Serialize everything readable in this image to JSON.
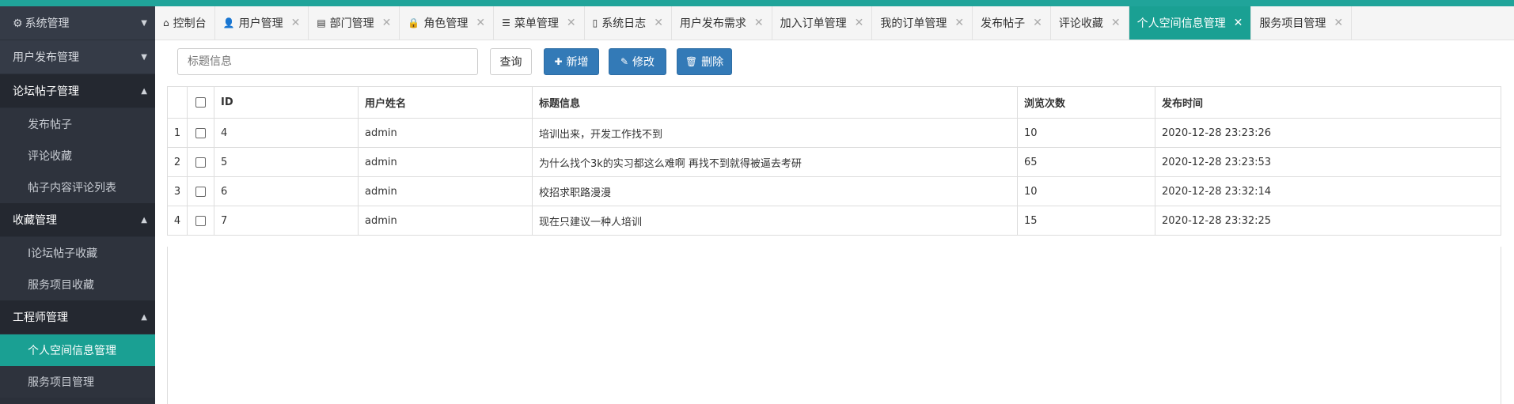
{
  "sidebar": {
    "items": [
      {
        "type": "group",
        "label": "系统管理",
        "icon": "gear-icon",
        "arrow": "▼",
        "open": false
      },
      {
        "type": "group",
        "label": "用户发布管理",
        "arrow": "▼",
        "open": false
      },
      {
        "type": "group",
        "label": "论坛帖子管理",
        "arrow": "▲",
        "open": true
      },
      {
        "type": "sub",
        "label": "发布帖子"
      },
      {
        "type": "sub",
        "label": "评论收藏"
      },
      {
        "type": "sub",
        "label": "帖子内容评论列表"
      },
      {
        "type": "group",
        "label": "收藏管理",
        "arrow": "▲",
        "open": true
      },
      {
        "type": "sub",
        "label": "I论坛帖子收藏"
      },
      {
        "type": "sub",
        "label": "服务项目收藏"
      },
      {
        "type": "group",
        "label": "工程师管理",
        "arrow": "▲",
        "open": true
      },
      {
        "type": "sub",
        "label": "个人空间信息管理",
        "active": true
      },
      {
        "type": "sub",
        "label": "服务项目管理"
      }
    ]
  },
  "tabs": [
    {
      "label": "控制台",
      "icon": "home-icon",
      "glyph": "⌂",
      "closable": false
    },
    {
      "label": "用户管理",
      "icon": "user-icon",
      "glyph": "👤",
      "closable": true
    },
    {
      "label": "部门管理",
      "icon": "document-icon",
      "glyph": "▤",
      "closable": true
    },
    {
      "label": "角色管理",
      "icon": "lock-icon",
      "glyph": "🔒",
      "closable": true
    },
    {
      "label": "菜单管理",
      "icon": "list-icon",
      "glyph": "☰",
      "closable": true
    },
    {
      "label": "系统日志",
      "icon": "file-icon",
      "glyph": "▯",
      "closable": true
    },
    {
      "label": "用户发布需求",
      "closable": true
    },
    {
      "label": "加入订单管理",
      "closable": true
    },
    {
      "label": "我的订单管理",
      "closable": true
    },
    {
      "label": "发布帖子",
      "closable": true
    },
    {
      "label": "评论收藏",
      "closable": true
    },
    {
      "label": "个人空间信息管理",
      "closable": true,
      "active": true
    },
    {
      "label": "服务项目管理",
      "closable": true
    }
  ],
  "toolbar": {
    "search_placeholder": "标题信息",
    "query_label": "查询",
    "add_label": "新增",
    "edit_label": "修改",
    "delete_label": "删除"
  },
  "table": {
    "columns": [
      "ID",
      "用户姓名",
      "标题信息",
      "浏览次数",
      "发布时间"
    ],
    "rows": [
      {
        "index": "1",
        "id": "4",
        "user": "admin",
        "title": "培训出来，开发工作找不到",
        "views": "10",
        "time": "2020-12-28 23:23:26"
      },
      {
        "index": "2",
        "id": "5",
        "user": "admin",
        "title": "为什么找个3k的实习都这么难啊 再找不到就得被逼去考研",
        "views": "65",
        "time": "2020-12-28 23:23:53"
      },
      {
        "index": "3",
        "id": "6",
        "user": "admin",
        "title": "校招求职路漫漫",
        "views": "10",
        "time": "2020-12-28 23:32:14"
      },
      {
        "index": "4",
        "id": "7",
        "user": "admin",
        "title": "现在只建议一种人培训",
        "views": "15",
        "time": "2020-12-28 23:32:25"
      }
    ]
  },
  "colors": {
    "accent": "#1aa093",
    "primary": "#337ab7",
    "sidebar": "#2b303a"
  }
}
